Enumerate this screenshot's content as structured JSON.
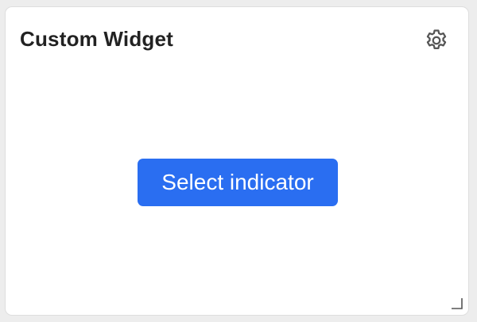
{
  "widget": {
    "title": "Custom Widget",
    "settings_icon": "gear-icon",
    "select_button_label": "Select indicator",
    "resize_icon": "resize-corner-icon"
  },
  "colors": {
    "accent": "#2a6ef1",
    "title_text": "#222222",
    "icon": "#555555",
    "card_border": "#dedede",
    "background": "#ededed"
  }
}
